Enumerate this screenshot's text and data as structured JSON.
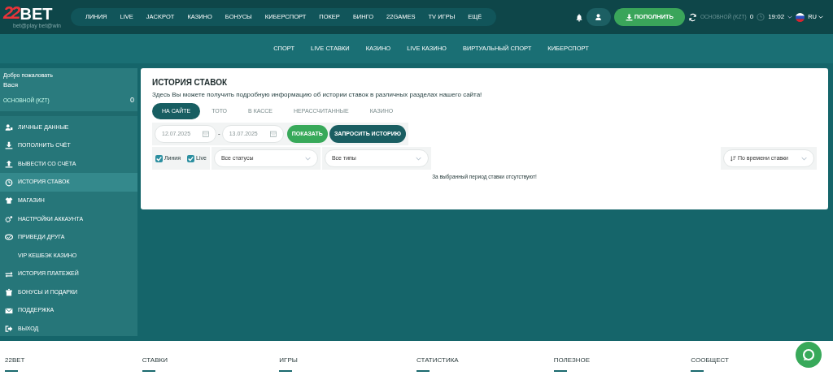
{
  "logo": {
    "digits": "22",
    "text": "BET",
    "tagline": "bet@play bet@win"
  },
  "top_nav": [
    "ЛИНИЯ",
    "LIVE",
    "JACKPOT",
    "КАЗИНО",
    "БОНУСЫ",
    "КИБЕРСПОРТ",
    "ПОКЕР",
    "БИНГО",
    "22GAMES",
    "TV ИГРЫ",
    "ЕЩЁ"
  ],
  "deposit_button": "ПОПОЛНИТЬ",
  "balance": {
    "label": "ОСНОВНОЙ (KZT)",
    "amount": "0"
  },
  "time": "19:02",
  "language": "RU",
  "sub_nav": [
    "СПОРТ",
    "LIVE СТАВКИ",
    "КАЗИНО",
    "LIVE КАЗИНО",
    "ВИРТУАЛЬНЫЙ СПОРТ",
    "КИБЕРСПОРТ"
  ],
  "sidebar": {
    "welcome": "Добро пожаловать",
    "user": "Вася",
    "account": {
      "label": "ОСНОВНОЙ (KZT)",
      "amount": "0"
    },
    "items": [
      {
        "label": "ЛИЧНЫЕ ДАННЫЕ",
        "selected": false,
        "kind": "icon"
      },
      {
        "label": "ПОПОЛНИТЬ СЧЁТ",
        "selected": false,
        "kind": "icon"
      },
      {
        "label": "ВЫВЕСТИ СО СЧЁТА",
        "selected": false,
        "kind": "icon"
      },
      {
        "label": "ИСТОРИЯ СТАВОК",
        "selected": true,
        "kind": "icon"
      },
      {
        "label": "МАГАЗИН",
        "selected": false,
        "kind": "icon"
      },
      {
        "label": "НАСТРОЙКИ АККАУНТА",
        "selected": false,
        "kind": "icon"
      },
      {
        "label": "ПРИВЕДИ ДРУГА",
        "selected": false,
        "kind": "icon"
      },
      {
        "label": "VIP КЕШБЭК КАЗИНО",
        "selected": false,
        "kind": "sub"
      },
      {
        "label": "ИСТОРИЯ ПЛАТЕЖЕЙ",
        "selected": false,
        "kind": "icon"
      },
      {
        "label": "БОНУСЫ И ПОДАРКИ",
        "selected": false,
        "kind": "icon"
      },
      {
        "label": "ПОДДЕРЖКА",
        "selected": false,
        "kind": "icon"
      },
      {
        "label": "ВЫХОД",
        "selected": false,
        "kind": "icon"
      }
    ]
  },
  "main": {
    "title": "ИСТОРИЯ СТАВОК",
    "description": "Здесь Вы можете получить подробную информацию об истории ставок в различных разделах нашего сайта!",
    "tabs": [
      {
        "label": "НА САЙТЕ",
        "selected": true
      },
      {
        "label": "ТОТО",
        "selected": false
      },
      {
        "label": "В КАССЕ",
        "selected": false
      },
      {
        "label": "НЕРАССЧИТАННЫЕ",
        "selected": false
      },
      {
        "label": "КАЗИНО",
        "selected": false
      }
    ],
    "date_from": "12.07.2025",
    "separator": "-",
    "date_to": "13.07.2025",
    "show_button": "ПОКАЗАТЬ",
    "request_button": "ЗАПРОСИТЬ ИСТОРИЮ",
    "checkboxes": [
      {
        "label": "Линия",
        "checked": true
      },
      {
        "label": "Live",
        "checked": true
      }
    ],
    "status_select": "Все статусы",
    "type_select": "Все типы",
    "sort_select": "По времени ставки",
    "empty_message": "За выбранный период ставки отсутствуют!"
  },
  "footer": [
    "22BET",
    "СТАВКИ",
    "ИГРЫ",
    "СТАТИСТИКА",
    "ПОЛЕЗНОЕ",
    "СООБЩЕСТ"
  ]
}
